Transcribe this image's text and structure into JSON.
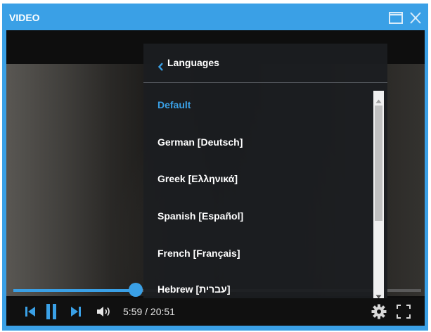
{
  "window": {
    "title": "VIDEO",
    "accent_color": "#3aa0e6",
    "buttons": [
      "maximize-icon",
      "close-icon"
    ]
  },
  "player": {
    "time_display": "5:59 / 20:51",
    "progress_fraction": 0.3,
    "controls": [
      "skip-back-icon",
      "pause-icon",
      "skip-forward-icon",
      "volume-icon",
      "gear-icon",
      "fullscreen-icon"
    ]
  },
  "language_menu": {
    "header": "Languages",
    "items": [
      {
        "label": "Default",
        "selected": true
      },
      {
        "label": "German [Deutsch]",
        "selected": false
      },
      {
        "label": "Greek [Ελληνικά]",
        "selected": false
      },
      {
        "label": "Spanish [Español]",
        "selected": false
      },
      {
        "label": "French [Français]",
        "selected": false
      },
      {
        "label": "Hebrew [עברית]",
        "selected": false
      }
    ]
  }
}
